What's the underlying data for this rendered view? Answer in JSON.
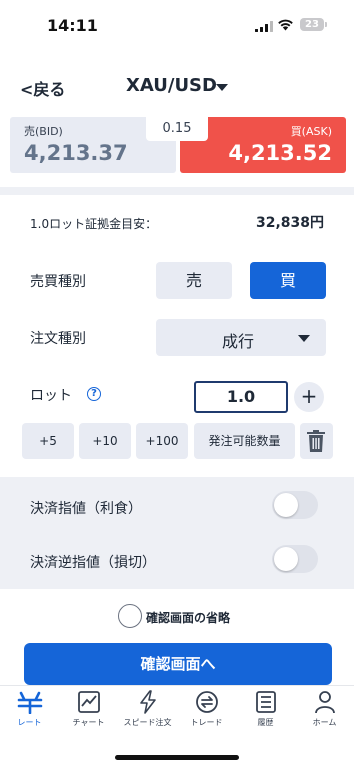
{
  "status_bar": {
    "time": "14:11",
    "battery": "23"
  },
  "header": {
    "back_label": "<戻る",
    "symbol": "XAU/USD"
  },
  "prices": {
    "bid_label": "売(BID)",
    "bid": "4,213.37",
    "ask_label": "買(ASK)",
    "ask": "4,213.52",
    "spread": "0.15"
  },
  "form": {
    "margin_label": "1.0ロット証拠金目安：",
    "margin_value": "32,838円",
    "side_label": "売買種別",
    "sell_label": "売",
    "buy_label": "買",
    "selected_side": "買",
    "order_type_label": "注文種別",
    "order_type_value": "成行",
    "lot_label": "ロット",
    "help_icon_text": "?",
    "lot_value": "1.0",
    "plus_label": "+",
    "lot_chips": [
      "+5",
      "+10",
      "+100",
      "発注可能数量"
    ],
    "take_profit_label": "決済指値（利食）",
    "take_profit_enabled": false,
    "stop_loss_label": "決済逆指値（損切）",
    "stop_loss_enabled": false,
    "skip_confirm_label": "確認画面の省略",
    "skip_confirm_checked": false,
    "confirm_button": "確認画面へ"
  },
  "tabbar": {
    "items": [
      {
        "label": "レート",
        "icon": "rate-icon",
        "active": true
      },
      {
        "label": "チャート",
        "icon": "chart-icon",
        "active": false
      },
      {
        "label": "スピード注文",
        "icon": "lightning-icon",
        "active": false
      },
      {
        "label": "トレード",
        "icon": "trade-icon",
        "active": false
      },
      {
        "label": "履歴",
        "icon": "history-icon",
        "active": false
      },
      {
        "label": "ホーム",
        "icon": "home-person-icon",
        "active": false
      }
    ]
  },
  "colors": {
    "accent": "#1565d8",
    "ask_red": "#f0524a",
    "panel_grey": "#e8ebf3"
  }
}
